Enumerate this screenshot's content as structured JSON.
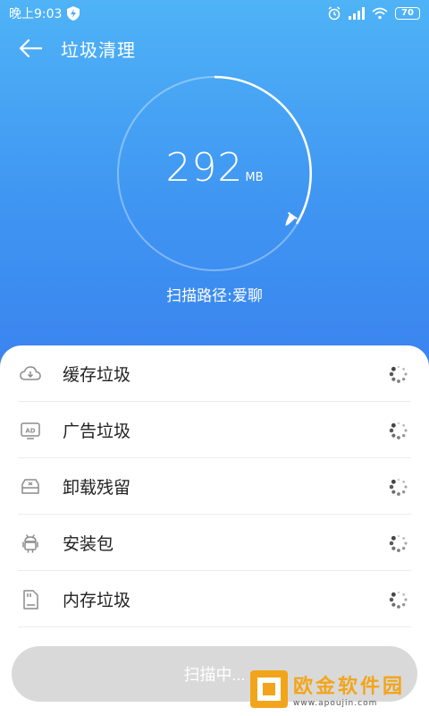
{
  "status_bar": {
    "time": "晚上9:03",
    "battery": "70"
  },
  "app_bar": {
    "title": "垃圾清理"
  },
  "scan": {
    "size_value": "292",
    "size_unit": "MB",
    "path_text": "扫描路径:爱聊"
  },
  "categories": [
    {
      "label": "缓存垃圾",
      "icon": "cloud-download-icon"
    },
    {
      "label": "广告垃圾",
      "icon": "ad-icon"
    },
    {
      "label": "卸载残留",
      "icon": "uninstall-icon"
    },
    {
      "label": "安装包",
      "icon": "android-icon"
    },
    {
      "label": "内存垃圾",
      "icon": "memory-card-icon"
    }
  ],
  "button": {
    "label": "扫描中..."
  },
  "watermark": {
    "name": "欧金软件园",
    "url": "www.apoujin.com"
  },
  "colors": {
    "hero_top": "#4fb3f6",
    "hero_bottom": "#3a83ef",
    "button_disabled": "#d9d9d9",
    "watermark_accent": "#f2a51a"
  }
}
